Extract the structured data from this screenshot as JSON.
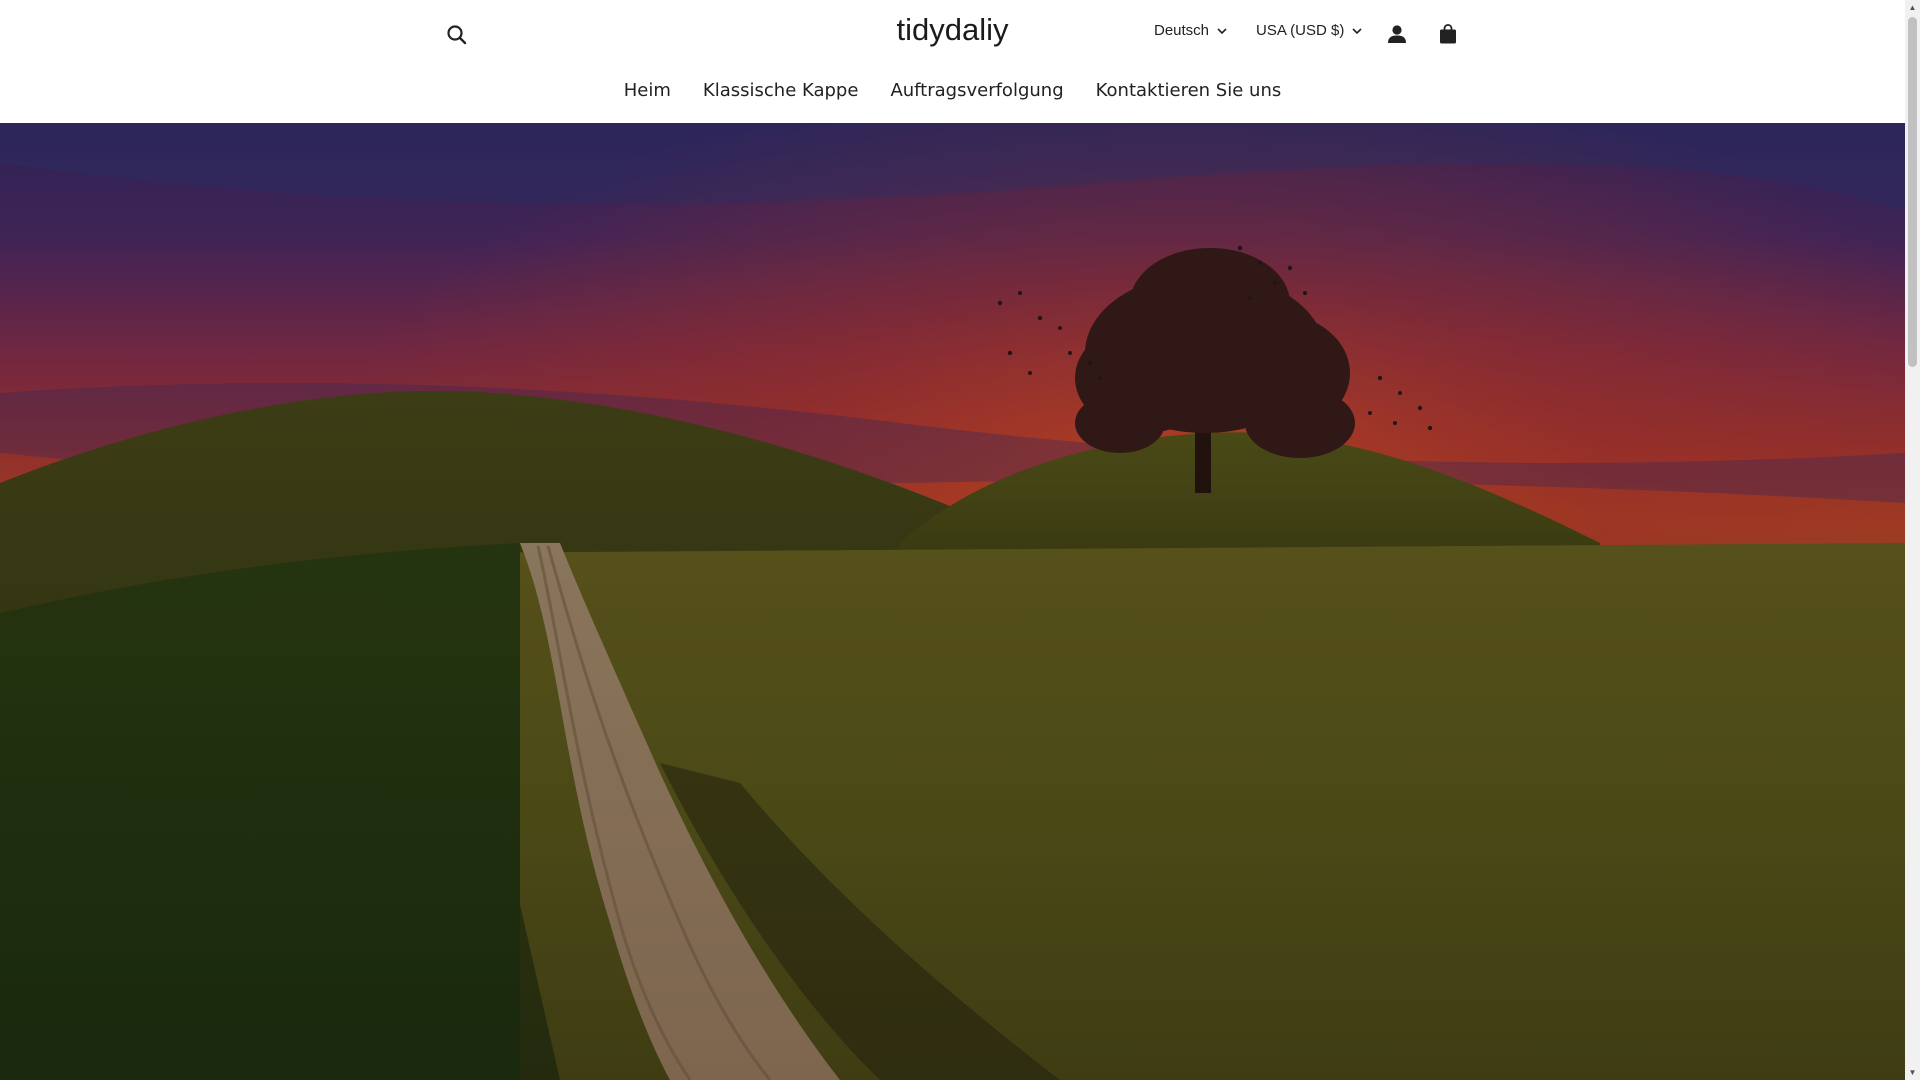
{
  "store": {
    "name": "tidydaliy"
  },
  "header": {
    "language": "Deutsch",
    "currency": "USA (USD $)"
  },
  "nav": {
    "items": [
      {
        "label": "Heim"
      },
      {
        "label": "Klassische Kappe"
      },
      {
        "label": "Auftragsverfolgung"
      },
      {
        "label": "Kontaktieren Sie uns"
      }
    ]
  },
  "icons": {
    "search": "search-icon",
    "account": "user-icon",
    "cart": "shopping-bag-icon",
    "dropdown": "chevron-down-icon"
  },
  "colors": {
    "header_bg": "#ffffff",
    "text": "#222222",
    "sky_top": "#3a2a6e",
    "sky_glow": "#d94a2a",
    "field": "#5e5a1a"
  }
}
